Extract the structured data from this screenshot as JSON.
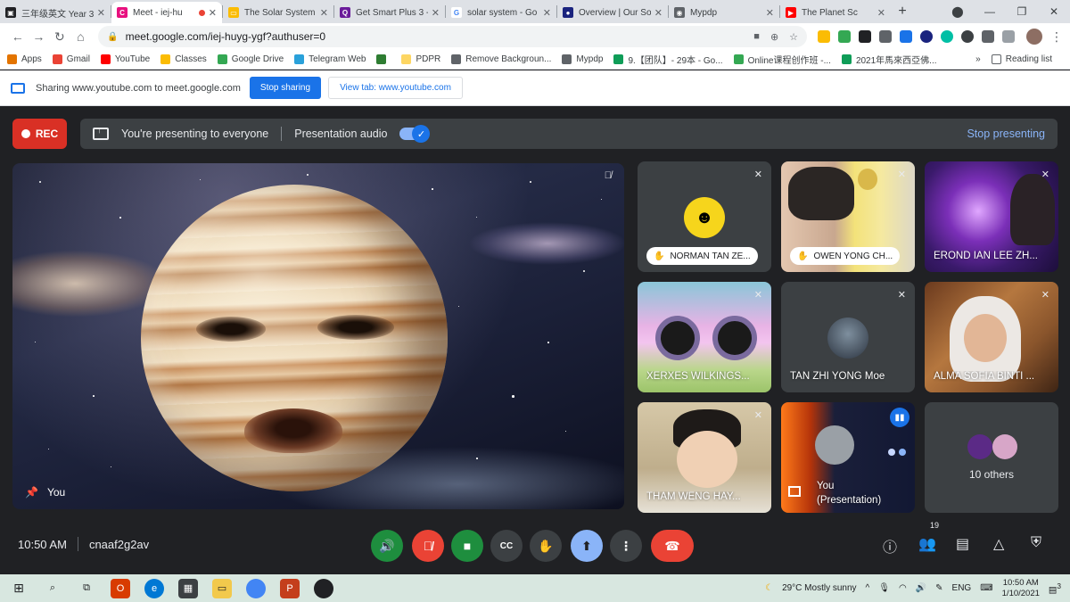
{
  "browser": {
    "tabs": [
      {
        "label": "三年级英文 Year 3",
        "color": "#202124",
        "glyph": "▣"
      },
      {
        "label": "Meet - iej-hu",
        "color": "#e8117f",
        "glyph": "C",
        "active": true,
        "recording": true
      },
      {
        "label": "The Solar System",
        "color": "#fbbc04",
        "glyph": "▭"
      },
      {
        "label": "Get Smart Plus 3 -",
        "color": "#6a1b9a",
        "glyph": "Q"
      },
      {
        "label": "solar system - Go",
        "color": "#ffffff",
        "glyph": "G"
      },
      {
        "label": "Overview | Our So",
        "color": "#1a237e",
        "glyph": "●"
      },
      {
        "label": "Mypdp",
        "color": "#5f6368",
        "glyph": "◉"
      },
      {
        "label": "The Planet Sc",
        "color": "#ff0000",
        "glyph": "▶"
      }
    ],
    "url": "meet.google.com/iej-huyg-ygf?authuser=0",
    "bookmarks": [
      {
        "label": "Apps",
        "color": "#e37400"
      },
      {
        "label": "Gmail",
        "color": "#ea4335"
      },
      {
        "label": "YouTube",
        "color": "#ff0000"
      },
      {
        "label": "Classes",
        "color": "#fbbc04"
      },
      {
        "label": "Google Drive",
        "color": "#34a853"
      },
      {
        "label": "Telegram Web",
        "color": "#2aa1da"
      },
      {
        "label": "",
        "color": "#2e7d32"
      },
      {
        "label": "PDPR",
        "color": "#fdd663"
      },
      {
        "label": "Remove Backgroun...",
        "color": "#5f6368"
      },
      {
        "label": "Mypdp",
        "color": "#5f6368"
      },
      {
        "label": "9.【团队】- 29本 - Go...",
        "color": "#0f9d58"
      },
      {
        "label": "Online课程创作班 -...",
        "color": "#34a853"
      },
      {
        "label": "2021年馬來西亞佛...",
        "color": "#0f9d58"
      }
    ],
    "reading_list": "Reading list"
  },
  "sharebar": {
    "text": "Sharing www.youtube.com to meet.google.com",
    "stop_label": "Stop sharing",
    "view_label": "View tab: www.youtube.com"
  },
  "meet": {
    "rec_label": "REC",
    "presenting_text": "You're presenting to everyone",
    "audio_label": "Presentation audio",
    "stop_presenting": "Stop presenting",
    "main_tile_name": "You",
    "participants": [
      {
        "name": "NORMAN TAN ZE...",
        "style": "pill",
        "hand": true
      },
      {
        "name": "OWEN YONG CH...",
        "style": "pill",
        "hand": true
      },
      {
        "name": "EROND IAN LEE ZH...",
        "style": "plain"
      },
      {
        "name": "XERXES WILKINGS...",
        "style": "plain"
      },
      {
        "name": "TAN ZHI YONG Moe",
        "style": "plain"
      },
      {
        "name": "ALMA SOFIA BINTI ...",
        "style": "plain"
      },
      {
        "name": "THAM WENG HAY...",
        "style": "plain"
      },
      {
        "name": "You\n(Presentation)",
        "style": "plain"
      },
      {
        "name": "10 others",
        "style": "center"
      }
    ],
    "time": "10:50 AM",
    "meeting_code": "cnaaf2g2av",
    "participant_count": "19",
    "colors": {
      "red": "#ea4335",
      "green": "#1e8e3e",
      "blue_active": "#8ab4f8",
      "bar": "#3c4043"
    }
  },
  "taskbar": {
    "weather": "29°C  Mostly sunny",
    "lang": "ENG",
    "clock_time": "10:50 AM",
    "clock_date": "1/10/2021",
    "notif": "3"
  }
}
